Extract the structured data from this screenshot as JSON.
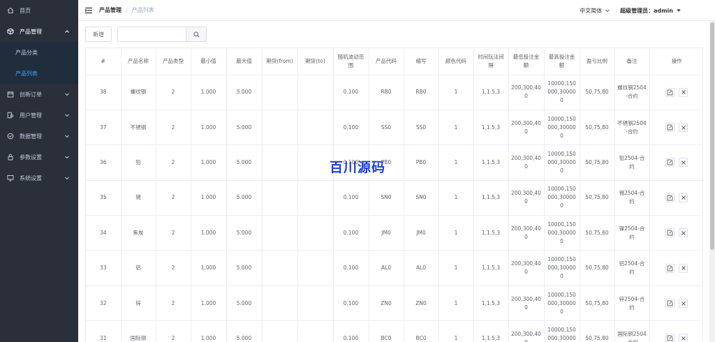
{
  "sidebar": {
    "items": [
      {
        "label": "首页",
        "icon": "home-icon"
      },
      {
        "label": "产品管理",
        "icon": "cube-icon",
        "open": true,
        "children": [
          {
            "label": "产品分类"
          },
          {
            "label": "产品列表",
            "active": true
          }
        ]
      },
      {
        "label": "创新订单",
        "icon": "calendar-icon"
      },
      {
        "label": "用户管理",
        "icon": "user-group-icon"
      },
      {
        "label": "数据管理",
        "icon": "check-circle-icon"
      },
      {
        "label": "参数设置",
        "icon": "lock-icon"
      },
      {
        "label": "系统设置",
        "icon": "monitor-icon"
      }
    ]
  },
  "header": {
    "breadcrumb": [
      "产品管理",
      "产品列表"
    ],
    "language": "中文简体",
    "user": "超级管理员：admin"
  },
  "toolbar": {
    "add_label": "新增",
    "search_value": "",
    "search_placeholder": ""
  },
  "table": {
    "columns": [
      "#",
      "产品名称",
      "产品类型",
      "最小值",
      "最大值",
      "期货(from)",
      "期货(to)",
      "随机波动范围",
      "产品代码",
      "缩写",
      "颜色代码",
      "时间玩法间隔",
      "最低投注金额",
      "最高投注金额",
      "盈亏比例",
      "备注",
      "操作"
    ],
    "rows": [
      {
        "id": "38",
        "name": "螺纹钢",
        "type": "2",
        "min": "1.000",
        "max": "5.000",
        "from": "",
        "to": "",
        "range": "0.100",
        "code": "RB0",
        "abbr": "RB0",
        "color": "1",
        "interval": "1,1.5,3",
        "min_bet": "200,300,400",
        "max_bet": "10000,150000,300000",
        "ratio": "50,75,80",
        "note": "螺纹钢2504-合约"
      },
      {
        "id": "37",
        "name": "不锈钢",
        "type": "2",
        "min": "1.000",
        "max": "5.000",
        "from": "",
        "to": "",
        "range": "0.100",
        "code": "SS0",
        "abbr": "SS0",
        "color": "1",
        "interval": "1,1.5,3",
        "min_bet": "200,300,400",
        "max_bet": "10000,150000,300000",
        "ratio": "50,75,80",
        "note": "不锈钢2504-合约"
      },
      {
        "id": "36",
        "name": "铅",
        "type": "2",
        "min": "1.000",
        "max": "5.000",
        "from": "",
        "to": "",
        "range": "0.100",
        "code": "PB0",
        "abbr": "PB0",
        "color": "1",
        "interval": "1,1.5,3",
        "min_bet": "200,300,400",
        "max_bet": "10000,150000,300000",
        "ratio": "50,75,80",
        "note": "铅2504-合约"
      },
      {
        "id": "35",
        "name": "锡",
        "type": "2",
        "min": "1.000",
        "max": "5.000",
        "from": "",
        "to": "",
        "range": "0.100",
        "code": "SN0",
        "abbr": "SN0",
        "color": "1",
        "interval": "1,1.5,3",
        "min_bet": "200,300,400",
        "max_bet": "10000,150000,300000",
        "ratio": "50,75,80",
        "note": "锡2504-合约"
      },
      {
        "id": "34",
        "name": "焦炭",
        "type": "2",
        "min": "1.000",
        "max": "5.000",
        "from": "",
        "to": "",
        "range": "0.100",
        "code": "JM0",
        "abbr": "JM0",
        "color": "1",
        "interval": "1,1.5,3",
        "min_bet": "200,300,400",
        "max_bet": "10000,150000,300000",
        "ratio": "50,75,80",
        "note": "镍2504-合约"
      },
      {
        "id": "33",
        "name": "铝",
        "type": "2",
        "min": "1.000",
        "max": "5.000",
        "from": "",
        "to": "",
        "range": "0.100",
        "code": "AL0",
        "abbr": "AL0",
        "color": "1",
        "interval": "1,1.5,3",
        "min_bet": "200,300,400",
        "max_bet": "10000,150000,300000",
        "ratio": "50,75,80",
        "note": "铝2504-合约"
      },
      {
        "id": "32",
        "name": "锌",
        "type": "2",
        "min": "1.000",
        "max": "5.000",
        "from": "",
        "to": "",
        "range": "0.100",
        "code": "ZN0",
        "abbr": "ZN0",
        "color": "1",
        "interval": "1,1.5,3",
        "min_bet": "200,300,400",
        "max_bet": "10000,150000,300000",
        "ratio": "50,75,80",
        "note": "锌2504-合约"
      },
      {
        "id": "31",
        "name": "国际铜",
        "type": "2",
        "min": "1.000",
        "max": "5.000",
        "from": "",
        "to": "",
        "range": "0.100",
        "code": "BC0",
        "abbr": "BC0",
        "color": "1",
        "interval": "1,1.5,3",
        "min_bet": "200,300,400",
        "max_bet": "10000,150000,300000",
        "ratio": "50,75,80",
        "note": "国际铜2504-合约"
      }
    ]
  },
  "watermark": "百川源码",
  "colors": {
    "sidebar_bg": "#2b2f3a",
    "active": "#409eff",
    "watermark": "#1f3fd6"
  }
}
